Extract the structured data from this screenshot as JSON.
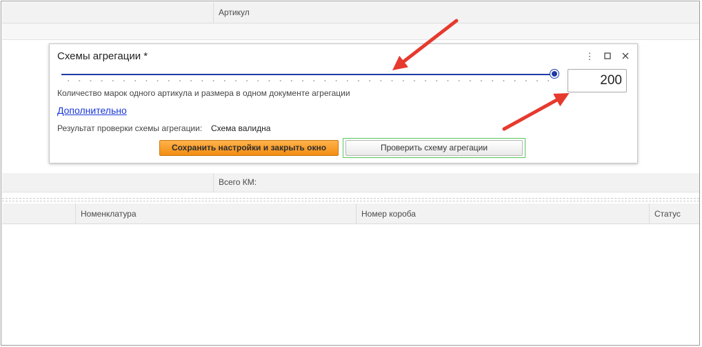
{
  "top_table": {
    "col_article": "Артикул"
  },
  "dialog": {
    "title": "Схемы агрегации *",
    "menu_icon": "more-vertical-icon",
    "maximize_icon": "maximize-icon",
    "close_icon": "close-icon",
    "slider": {
      "value": 200,
      "fraction": 1.0
    },
    "input_value": "200",
    "description": "Количество марок одного артикула и размера в одном документе агрегации",
    "link_more": "Дополнительно",
    "result_label": "Результат проверки схемы агрегации:",
    "result_value": "Схема валидна",
    "save_button": "Сохранить настройки и закрыть окно",
    "check_button": "Проверить схему агрегации"
  },
  "summary": {
    "total_label": "Всего КМ:"
  },
  "bottom_table": {
    "columns": [
      "Номенклатура",
      "Номер короба",
      "Статус"
    ]
  },
  "colors": {
    "accent_blue": "#1c3aa6",
    "primary_orange": "#f38d12",
    "annotation_red": "#e63a2e",
    "success_green": "#55c45a"
  }
}
